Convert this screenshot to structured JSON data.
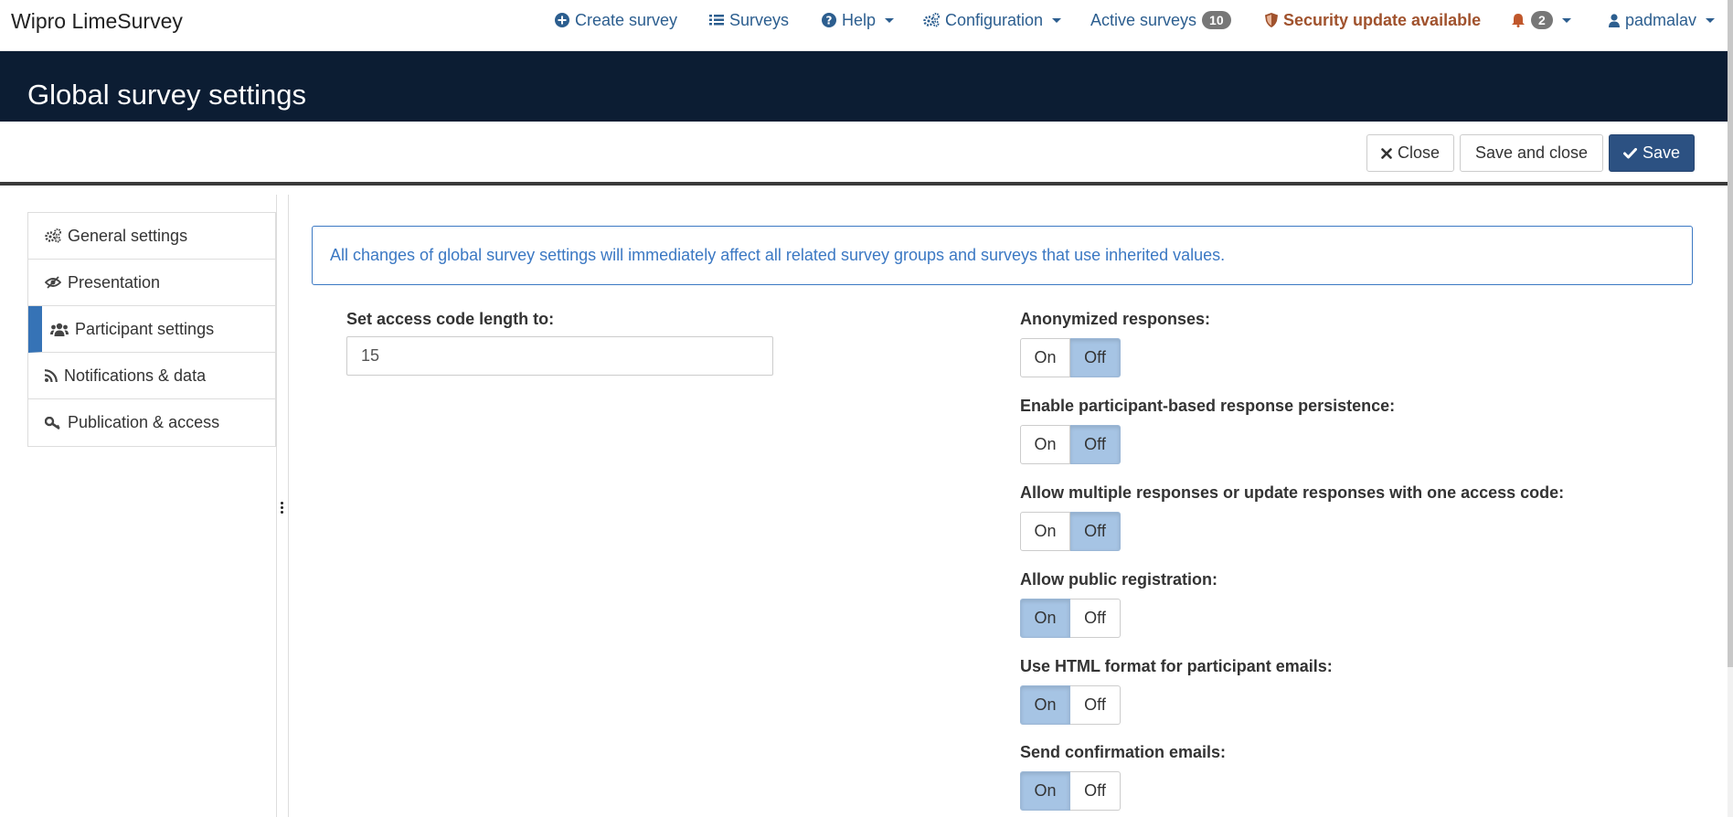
{
  "brand": "Wipro LimeSurvey",
  "nav": {
    "create_survey": "Create survey",
    "surveys": "Surveys",
    "help": "Help",
    "configuration": "Configuration",
    "active_surveys": "Active surveys",
    "active_surveys_count": "10",
    "security": "Security update available",
    "notifications_count": "2",
    "user": "padmalav"
  },
  "page_title": "Global survey settings",
  "toolbar": {
    "close": "Close",
    "save_and_close": "Save and close",
    "save": "Save"
  },
  "sidebar": {
    "items": [
      {
        "label": "General settings",
        "icon": "gears-icon"
      },
      {
        "label": "Presentation",
        "icon": "eye-slash-icon"
      },
      {
        "label": "Participant settings",
        "icon": "users-icon",
        "active": true
      },
      {
        "label": "Notifications & data",
        "icon": "rss-icon"
      },
      {
        "label": "Publication & access",
        "icon": "key-icon"
      }
    ]
  },
  "alert": "All changes of global survey settings will immediately affect all related survey groups and surveys that use inherited values.",
  "access_code": {
    "label": "Set access code length to:",
    "value": "15"
  },
  "toggles": {
    "on_label": "On",
    "off_label": "Off",
    "items": [
      {
        "label": "Anonymized responses:",
        "value": "Off"
      },
      {
        "label": "Enable participant-based response persistence:",
        "value": "Off"
      },
      {
        "label": "Allow multiple responses or update responses with one access code:",
        "value": "Off"
      },
      {
        "label": "Allow public registration:",
        "value": "On"
      },
      {
        "label": "Use HTML format for participant emails:",
        "value": "On"
      },
      {
        "label": "Send confirmation emails:",
        "value": "On"
      }
    ]
  },
  "colors": {
    "title_bar": "#0c1d33",
    "accent": "#2c5182",
    "toggle_selected": "#a6c4e4",
    "alert": "#3b78c3",
    "security": "#a0522d"
  }
}
